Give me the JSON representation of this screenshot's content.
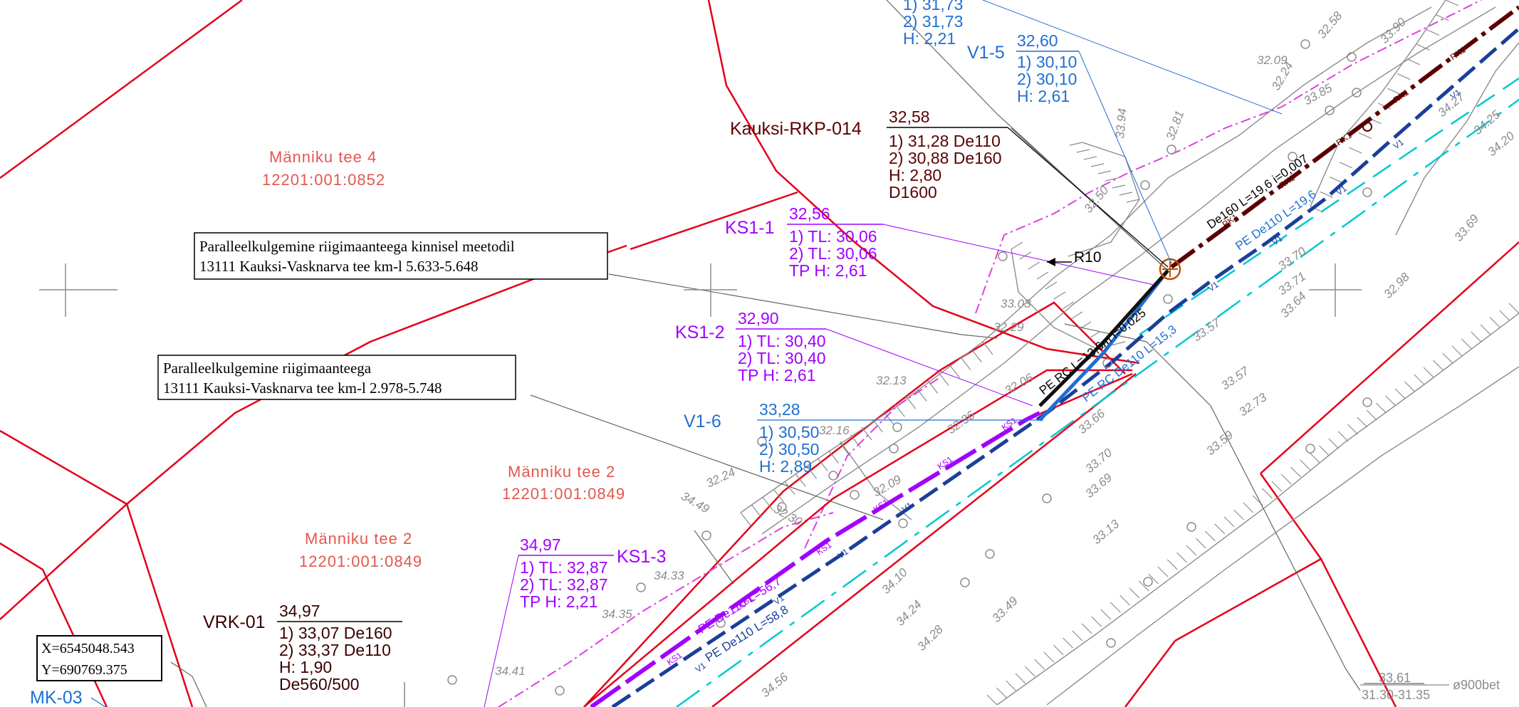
{
  "colors": {
    "boundary": "#e3001b",
    "water": "#1f6fd1",
    "sewer": "#a100ff",
    "rain": "#5a0000",
    "parcel": "#e2574c",
    "road_green": "#00c8d0",
    "cad_gray": "#8c8c8c"
  },
  "parcels": [
    {
      "name": "Männiku tee 4",
      "id": "12201:001:0852"
    },
    {
      "name": "Männiku tee 2",
      "id": "12201:001:0849"
    },
    {
      "name": "Männiku tee 2",
      "id": "12201:001:0849"
    }
  ],
  "notes": [
    {
      "line1": "Paralleelkulgemine riigimaanteega kinnisel meetodil",
      "line2": "13111 Kauksi-Vasknarva tee km-l 5.633-5.648"
    },
    {
      "line1": "Paralleelkulgemine riigimaanteega",
      "line2": "13111 Kauksi-Vasknarva tee km-l 2.978-5.748"
    }
  ],
  "coord_box": {
    "x": "X=6545048.543",
    "y": "Y=690769.375"
  },
  "top_partial": {
    "l1": "1) 31,73",
    "l2": "2) 31,73",
    "l3": "H: 2,21"
  },
  "wells": {
    "v15": {
      "name": "V1-5",
      "top": "32,60",
      "l1": "1) 30,10",
      "l2": "2) 30,10",
      "l3": "H: 2,61"
    },
    "rkp": {
      "name": "Kauksi-RKP-014",
      "top": "32,58",
      "l1": "1) 31,28 De110",
      "l2": "2) 30,88 De160",
      "l3": "H: 2,80",
      "l4": "D1600"
    },
    "ks11": {
      "name": "KS1-1",
      "top": "32,56",
      "l1": "1) TL: 30,06",
      "l2": "2) TL: 30,06",
      "l3": "TP H: 2,61"
    },
    "ks12": {
      "name": "KS1-2",
      "top": "32,90",
      "l1": "1) TL: 30,40",
      "l2": "2) TL: 30,40",
      "l3": "TP H: 2,61"
    },
    "v16": {
      "name": "V1-6",
      "top": "33,28",
      "l1": "1) 30,50",
      "l2": "2) 30,50",
      "l3": "H: 2,89"
    },
    "ks13": {
      "name": "KS1-3",
      "top": "34,97",
      "l1": "1) TL: 32,87",
      "l2": "2) TL: 32,87",
      "l3": "TP H: 2,21"
    },
    "vrk": {
      "name": "VRK-01",
      "top": "34,97",
      "l1": "1) 33,07 De160",
      "l2": "2) 33,37 De110",
      "l3": "H: 1,90",
      "l4": "De560/500"
    },
    "mk": {
      "name": "MK-03"
    }
  },
  "pipes": {
    "de160": "De160 L=19,6 i=0,007",
    "pe_de110_top": "PE De110 L=19,6",
    "pe_rc": "PE RC L=13,6m i=0,025",
    "pe_rc_de110": "PE RC De110 L=15,3",
    "pe_de110_ks": "PE De110 L=56,7",
    "pe_de110_v": "PE De110 L=58,8",
    "r10": "R10"
  },
  "culvert": {
    "top": "33,61",
    "bottom": "31.30-31.35",
    "size": "ø900bet"
  },
  "elevations": [
    {
      "v": "32.09"
    },
    {
      "v": "32.58"
    },
    {
      "v": "33.90"
    },
    {
      "v": "32.24"
    },
    {
      "v": "33.85"
    },
    {
      "v": "34.27"
    },
    {
      "v": "34.25"
    },
    {
      "v": "34.20"
    },
    {
      "v": "33.94"
    },
    {
      "v": "32.81"
    },
    {
      "v": "32.50"
    },
    {
      "v": "33.03"
    },
    {
      "v": "32.29"
    },
    {
      "v": "32.13"
    },
    {
      "v": "32.06"
    },
    {
      "v": "32.16"
    },
    {
      "v": "32.36"
    },
    {
      "v": "32.24"
    },
    {
      "v": "32.09"
    },
    {
      "v": "32.30"
    },
    {
      "v": "34.49"
    },
    {
      "v": "34.33"
    },
    {
      "v": "34.35"
    },
    {
      "v": "34.41"
    },
    {
      "v": "33.57"
    },
    {
      "v": "33.70"
    },
    {
      "v": "33.71"
    },
    {
      "v": "33.64"
    },
    {
      "v": "32.98"
    },
    {
      "v": "33.69"
    },
    {
      "v": "33.57"
    },
    {
      "v": "32.73"
    },
    {
      "v": "33.66"
    },
    {
      "v": "33.70"
    },
    {
      "v": "33.69"
    },
    {
      "v": "33.13"
    },
    {
      "v": "33.59"
    },
    {
      "v": "34.10"
    },
    {
      "v": "34.24"
    },
    {
      "v": "34.28"
    },
    {
      "v": "33.49"
    },
    {
      "v": "34.56"
    }
  ],
  "codes": {
    "ks": "KS1",
    "v": "V1",
    "rk": "RK1"
  }
}
